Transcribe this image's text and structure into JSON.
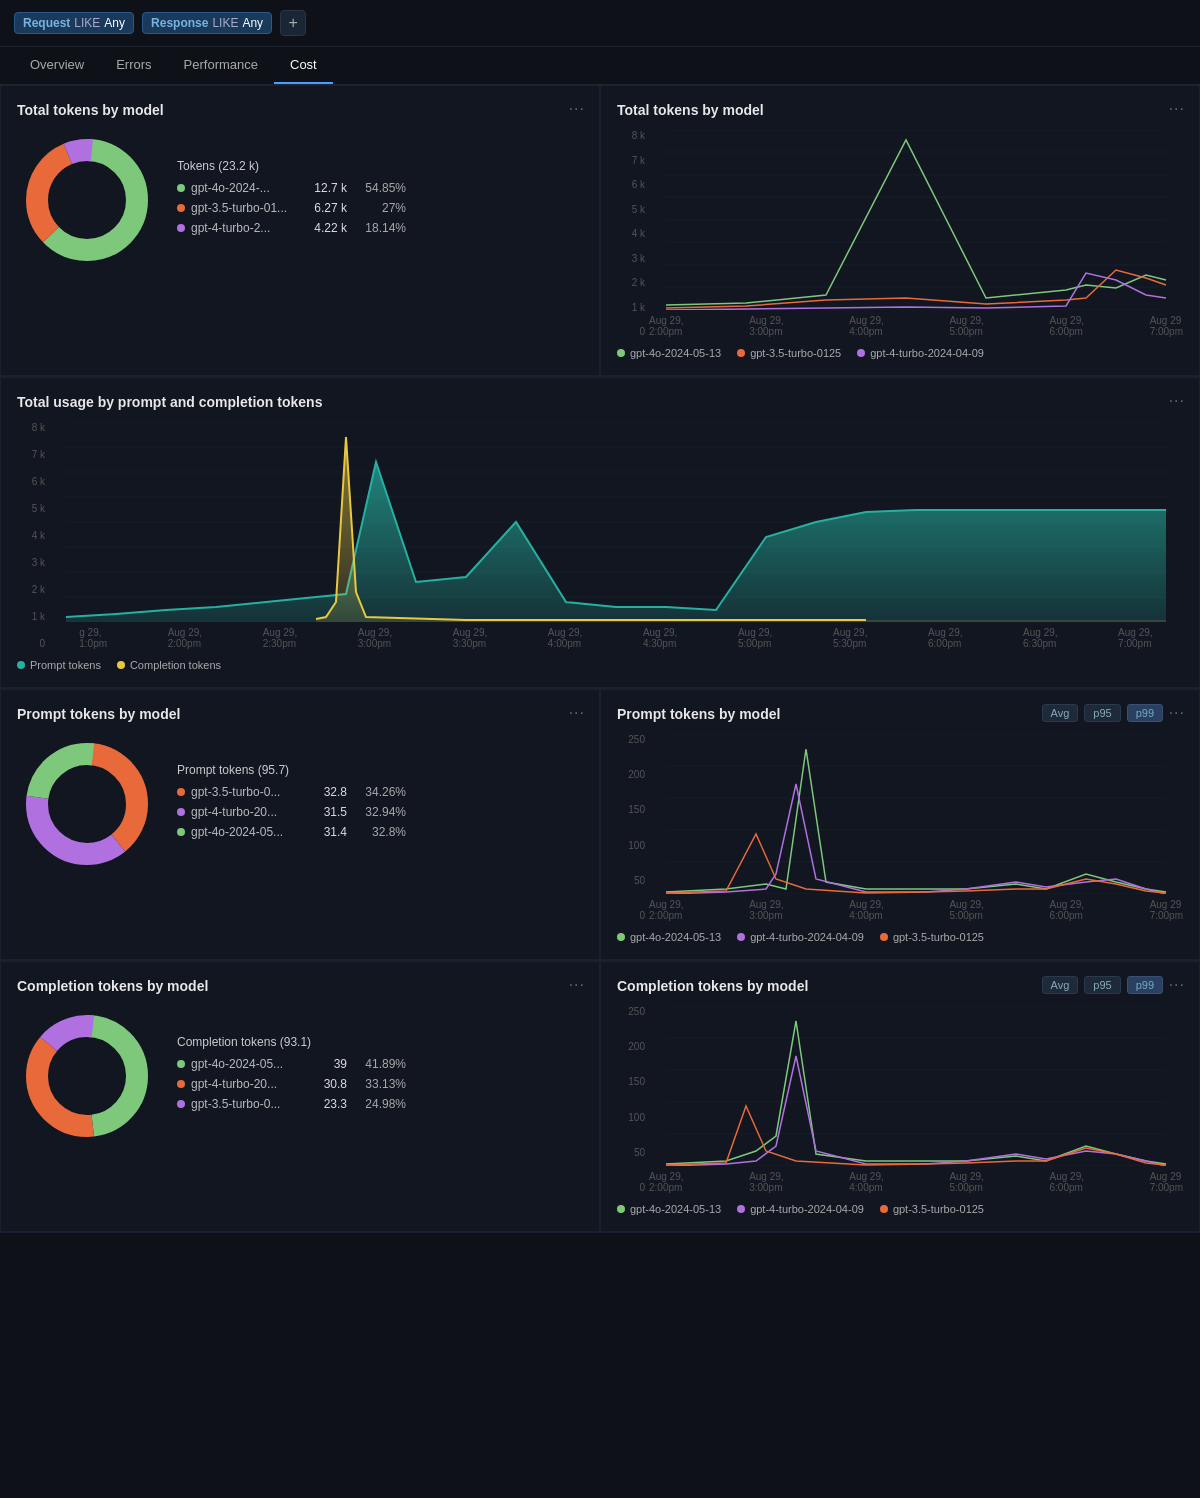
{
  "topbar": {
    "filters": [
      {
        "key": "Request",
        "op": "LIKE",
        "val": "Any"
      },
      {
        "key": "Response",
        "op": "LIKE",
        "val": "Any"
      }
    ],
    "add_label": "+"
  },
  "nav": {
    "tabs": [
      "Overview",
      "Errors",
      "Performance",
      "Cost"
    ],
    "active": "Cost"
  },
  "panels": {
    "total_tokens_donut": {
      "title": "Total tokens by model",
      "legend_title": "Tokens (23.2 k)",
      "items": [
        {
          "label": "gpt-4o-2024-...",
          "value": "12.7 k",
          "pct": "54.85%",
          "color": "#7dc87a"
        },
        {
          "label": "gpt-3.5-turbo-01...",
          "value": "6.27 k",
          "pct": "27%",
          "color": "#e86a3a"
        },
        {
          "label": "gpt-4-turbo-2...",
          "value": "4.22 k",
          "pct": "18.14%",
          "color": "#b070e0"
        }
      ]
    },
    "total_tokens_line": {
      "title": "Total tokens by model",
      "y_labels": [
        "8 k",
        "7 k",
        "6 k",
        "5 k",
        "4 k",
        "3 k",
        "2 k",
        "1 k",
        "0"
      ],
      "x_labels": [
        "Aug 29,\n2:00pm",
        "Aug 29,\n3:00pm",
        "Aug 29,\n4:00pm",
        "Aug 29,\n5:00pm",
        "Aug 29,\n6:00pm",
        "Aug 29\n7:00pm"
      ],
      "legend": [
        {
          "label": "gpt-4o-2024-05-13",
          "color": "#7dc87a"
        },
        {
          "label": "gpt-3.5-turbo-0125",
          "color": "#e86a3a"
        },
        {
          "label": "gpt-4-turbo-2024-04-09",
          "color": "#b070e0"
        }
      ]
    },
    "total_usage": {
      "title": "Total usage by prompt and completion tokens",
      "y_labels": [
        "8 k",
        "7 k",
        "6 k",
        "5 k",
        "4 k",
        "3 k",
        "2 k",
        "1 k",
        "0"
      ],
      "x_labels": [
        "g 29,\n1:0pm",
        "Aug 29,\n2:00pm",
        "Aug 29,\n2:30pm",
        "Aug 29,\n3:00pm",
        "Aug 29,\n3:30pm",
        "Aug 29,\n4:00pm",
        "Aug 29,\n4:30pm",
        "Aug 29,\n5:00pm",
        "Aug 29,\n5:30pm",
        "Aug 29,\n6:00pm",
        "Aug 29,\n6:30pm",
        "Aug 29,\n7:00pm"
      ],
      "legend": [
        {
          "label": "Prompt tokens",
          "color": "#26b0a0"
        },
        {
          "label": "Completion tokens",
          "color": "#e8c840"
        }
      ]
    },
    "prompt_tokens_donut": {
      "title": "Prompt tokens by model",
      "legend_title": "Prompt tokens (95.7)",
      "items": [
        {
          "label": "gpt-3.5-turbo-0...",
          "value": "32.8",
          "pct": "34.26%",
          "color": "#e86a3a"
        },
        {
          "label": "gpt-4-turbo-20...",
          "value": "31.5",
          "pct": "32.94%",
          "color": "#b070e0"
        },
        {
          "label": "gpt-4o-2024-05...",
          "value": "31.4",
          "pct": "32.8%",
          "color": "#7dc87a"
        }
      ]
    },
    "prompt_tokens_line": {
      "title": "Prompt tokens by model",
      "badges": [
        "Avg",
        "p95",
        "p99"
      ],
      "active_badge": "p99",
      "y_labels": [
        "250",
        "200",
        "150",
        "100",
        "50",
        "0"
      ],
      "x_labels": [
        "Aug 29,\n2:00pm",
        "Aug 29,\n3:00pm",
        "Aug 29,\n4:00pm",
        "Aug 29,\n5:00pm",
        "Aug 29,\n6:00pm",
        "Aug 29\n7:00pm"
      ],
      "legend": [
        {
          "label": "gpt-4o-2024-05-13",
          "color": "#7dc87a"
        },
        {
          "label": "gpt-4-turbo-2024-04-09",
          "color": "#b070e0"
        },
        {
          "label": "gpt-3.5-turbo-0125",
          "color": "#e86a3a"
        }
      ]
    },
    "completion_tokens_donut": {
      "title": "Completion tokens by model",
      "legend_title": "Completion tokens (93.1)",
      "items": [
        {
          "label": "gpt-4o-2024-05...",
          "value": "39",
          "pct": "41.89%",
          "color": "#7dc87a"
        },
        {
          "label": "gpt-4-turbo-20...",
          "value": "30.8",
          "pct": "33.13%",
          "color": "#e86a3a"
        },
        {
          "label": "gpt-3.5-turbo-0...",
          "value": "23.3",
          "pct": "24.98%",
          "color": "#b070e0"
        }
      ]
    },
    "completion_tokens_line": {
      "title": "Completion tokens by model",
      "badges": [
        "Avg",
        "p95",
        "p99"
      ],
      "active_badge": "p99",
      "y_labels": [
        "250",
        "200",
        "150",
        "100",
        "50",
        "0"
      ],
      "x_labels": [
        "Aug 29,\n2:00pm",
        "Aug 29,\n3:00pm",
        "Aug 29,\n4:00pm",
        "Aug 29,\n5:00pm",
        "Aug 29,\n6:00pm",
        "Aug 29\n7:00pm"
      ],
      "legend": [
        {
          "label": "gpt-4o-2024-05-13",
          "color": "#7dc87a"
        },
        {
          "label": "gpt-4-turbo-2024-04-09",
          "color": "#b070e0"
        },
        {
          "label": "gpt-3.5-turbo-0125",
          "color": "#e86a3a"
        }
      ]
    }
  }
}
